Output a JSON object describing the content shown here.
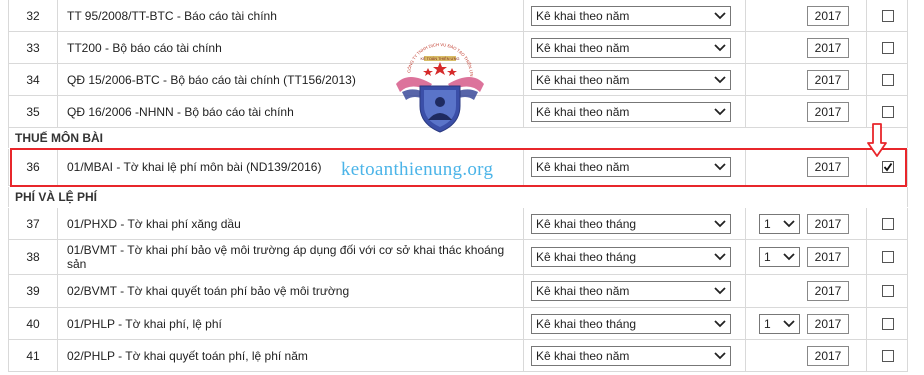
{
  "sections": {
    "thue_mon_bai": "THUẾ MÔN BÀI",
    "phi_le_phi": "PHÍ VÀ LỆ PHÍ"
  },
  "rows": [
    {
      "num": "32",
      "name": "TT 95/2008/TT-BTC - Báo cáo tài chính",
      "type": "Kê khai theo năm",
      "month": "",
      "year": "2017",
      "checked": false
    },
    {
      "num": "33",
      "name": "TT200 - Bộ báo cáo tài chính",
      "type": "Kê khai theo năm",
      "month": "",
      "year": "2017",
      "checked": false
    },
    {
      "num": "34",
      "name": "QĐ 15/2006-BTC - Bộ báo cáo tài chính (TT156/2013)",
      "type": "Kê khai theo năm",
      "month": "",
      "year": "2017",
      "checked": false
    },
    {
      "num": "35",
      "name": "QĐ 16/2006 -NHNN - Bộ báo cáo tài chính",
      "type": "Kê khai theo năm",
      "month": "",
      "year": "2017",
      "checked": false
    },
    {
      "num": "36",
      "name": "01/MBAI - Tờ khai lệ phí môn bài (ND139/2016)",
      "type": "Kê khai theo năm",
      "month": "",
      "year": "2017",
      "checked": true
    },
    {
      "num": "37",
      "name": "01/PHXD - Tờ khai phí xăng dầu",
      "type": "Kê khai theo tháng",
      "month": "1",
      "year": "2017",
      "checked": false
    },
    {
      "num": "38",
      "name": "01/BVMT - Tờ khai phí bảo vệ môi trường áp dụng đối với cơ sở khai thác khoáng sản",
      "type": "Kê khai theo tháng",
      "month": "1",
      "year": "2017",
      "checked": false
    },
    {
      "num": "39",
      "name": "02/BVMT - Tờ khai quyết toán phí bảo vệ môi trường",
      "type": "Kê khai theo năm",
      "month": "",
      "year": "2017",
      "checked": false
    },
    {
      "num": "40",
      "name": "01/PHLP - Tờ khai phí, lệ phí",
      "type": "Kê khai theo tháng",
      "month": "1",
      "year": "2017",
      "checked": false
    },
    {
      "num": "41",
      "name": "02/PHLP - Tờ khai quyết toán phí, lệ phí năm",
      "type": "Kê khai theo năm",
      "month": "",
      "year": "2017",
      "checked": false
    }
  ],
  "watermark": "ketoanthienung.org",
  "logo": {
    "ring_text": "CÔNG TY TNHH DỊCH VỤ ĐÀO TẠO THIÊN ƯNG",
    "banner_text": "KẾ TOÁN THIÊN ƯNG",
    "icon": "eagle-shield-logo"
  },
  "icons": {
    "dropdown": "chevron-down-icon",
    "arrow": "down-arrow-icon",
    "check": "checkmark-icon"
  },
  "colors": {
    "highlight": "#e8262b",
    "watermark": "#4bb4e8",
    "arrow": "#e8262b"
  }
}
